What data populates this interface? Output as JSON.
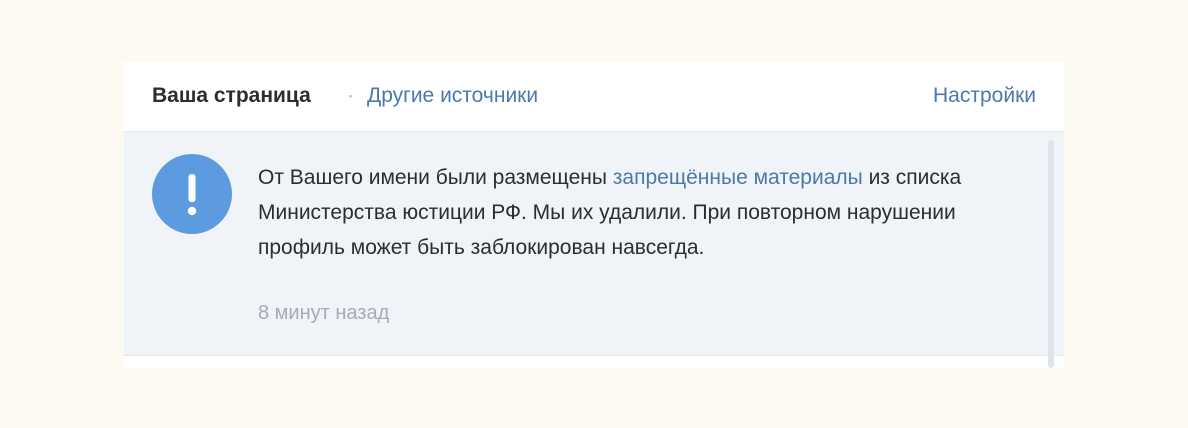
{
  "header": {
    "tab_active": "Ваша страница",
    "separator": "·",
    "tab_other": "Другие источники",
    "settings": "Настройки"
  },
  "notification": {
    "icon": "exclamation-icon",
    "text_before": "От Вашего имени были размещены ",
    "text_link": "запрещённые материалы",
    "text_after": " из списка Министерства юстиции РФ. Мы их удалили. При повторном нарушении профиль может быть заблокирован навсегда.",
    "time": "8 минут назад"
  },
  "colors": {
    "background": "#fdfaf1",
    "link": "#4c7aa8",
    "icon_bg": "#5d9be0",
    "notification_bg": "#f0f3f7",
    "muted_text": "#a6acb5"
  }
}
